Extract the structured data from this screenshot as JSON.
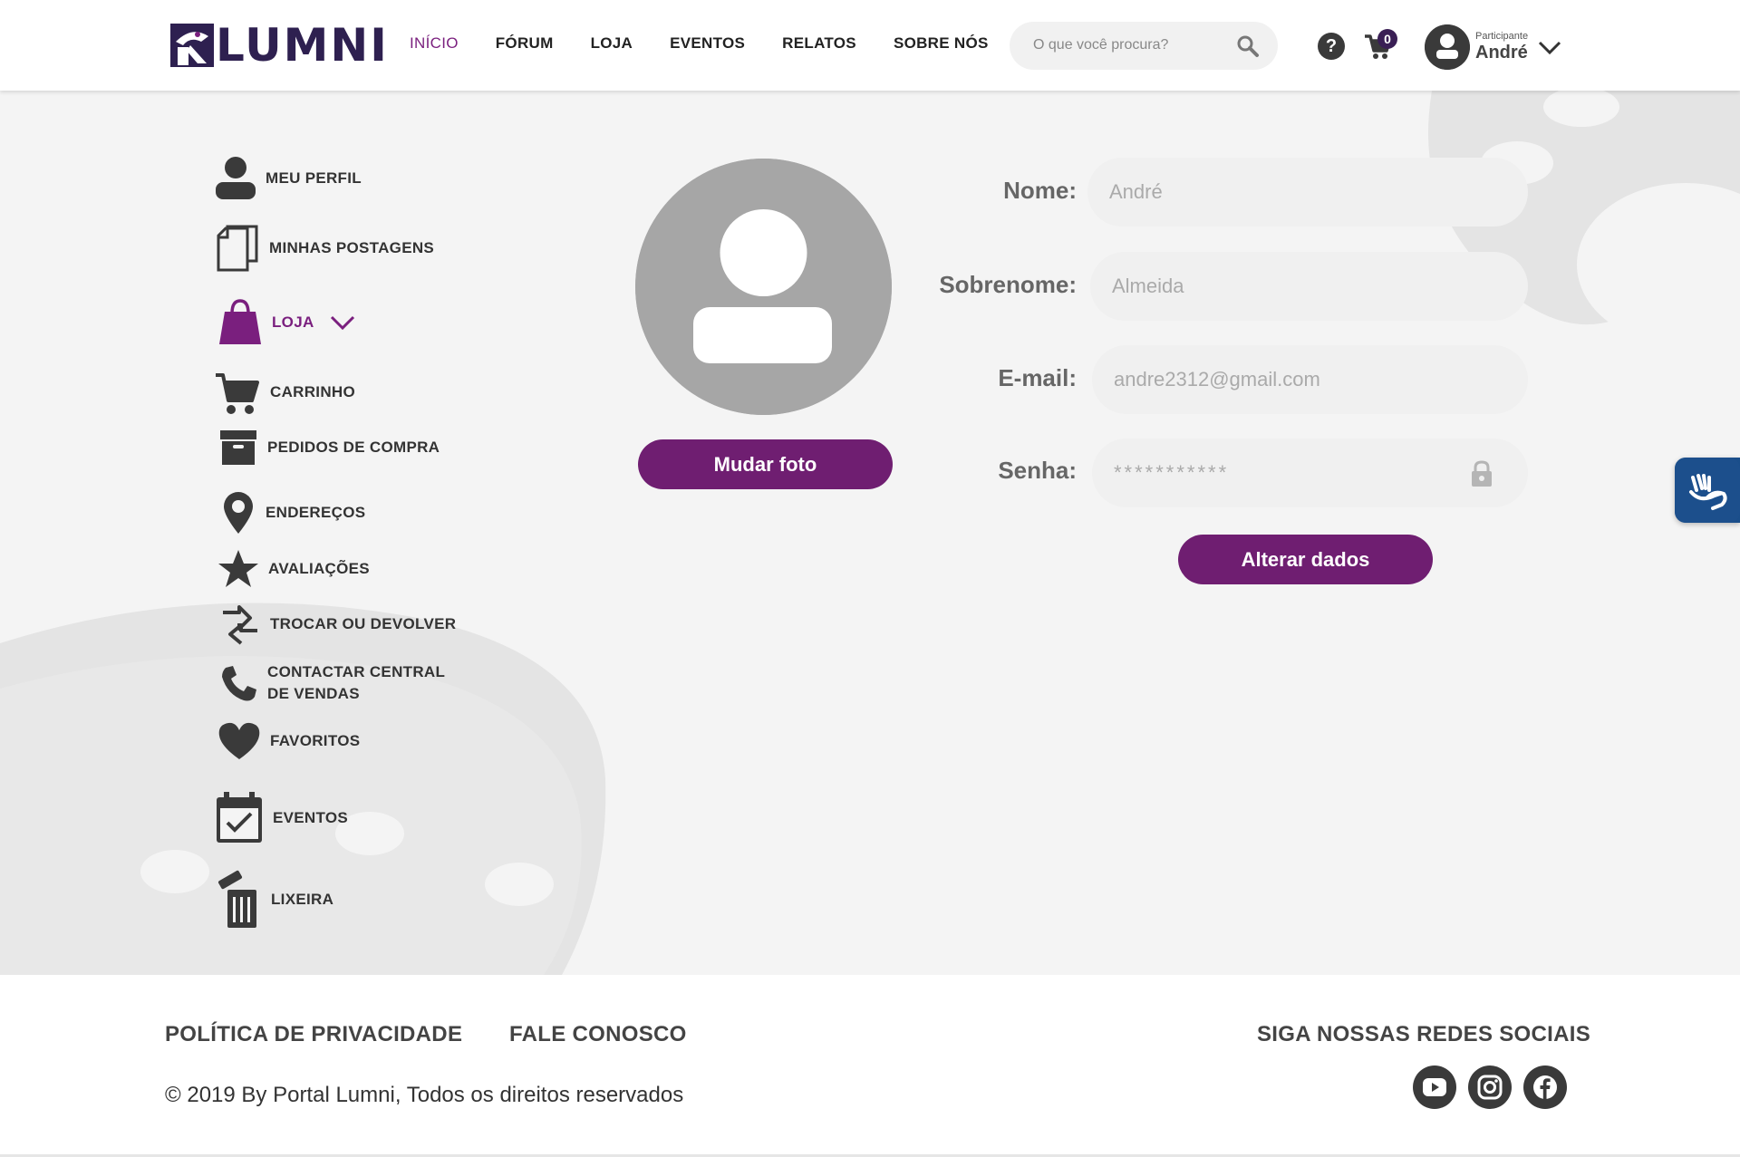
{
  "header": {
    "logo_text": "LUMNI",
    "nav": [
      "INÍCIO",
      "FÓRUM",
      "LOJA",
      "EVENTOS",
      "RELATOS",
      "SOBRE NÓS"
    ],
    "active_nav": "INÍCIO",
    "search_placeholder": "O que você procura?",
    "cart_count": "0",
    "user_role": "Participante",
    "user_name": "André",
    "icons": [
      "search-icon",
      "help-icon",
      "cart-icon",
      "avatar-icon",
      "chevron-down-icon"
    ]
  },
  "sidebar": {
    "items": [
      {
        "label": "MEU PERFIL",
        "icon": "user-icon"
      },
      {
        "label": "MINHAS POSTAGENS",
        "icon": "documents-icon"
      },
      {
        "label": "LOJA",
        "icon": "shopping-bag-icon",
        "active": true
      },
      {
        "label": "CARRINHO",
        "icon": "cart-icon"
      },
      {
        "label": "PEDIDOS DE COMPRA",
        "icon": "box-icon"
      },
      {
        "label": "ENDEREÇOS",
        "icon": "location-pin-icon"
      },
      {
        "label": "AVALIAÇÕES",
        "icon": "star-icon"
      },
      {
        "label": "TROCAR OU DEVOLVER",
        "icon": "exchange-icon"
      },
      {
        "label": "CONTACTAR CENTRAL",
        "label2": "DE VENDAS",
        "icon": "phone-icon"
      },
      {
        "label": "FAVORITOS",
        "icon": "heart-icon"
      },
      {
        "label": "EVENTOS",
        "icon": "calendar-check-icon"
      },
      {
        "label": "LIXEIRA",
        "icon": "trash-icon"
      }
    ]
  },
  "profile": {
    "change_photo_label": "Mudar foto",
    "fields": {
      "name_label": "Nome:",
      "name_value": "André",
      "surname_label": "Sobrenome:",
      "surname_value": "Almeida",
      "email_label": "E-mail:",
      "email_value": "andre2312@gmail.com",
      "password_label": "Senha:",
      "password_value": "***********"
    },
    "submit_label": "Alterar dados"
  },
  "footer": {
    "privacy": "POLÍTICA DE PRIVACIDADE",
    "contact": "FALE CONOSCO",
    "social_title": "SIGA NOSSAS REDES SOCIAIS",
    "copyright": "© 2019 By Portal Lumni, Todos os direitos reservados",
    "social_icons": [
      "youtube-icon",
      "instagram-icon",
      "facebook-icon"
    ]
  },
  "colors": {
    "accent": "#6f1e71",
    "background": "#f4f4f4",
    "icon": "#3a3a3a"
  }
}
